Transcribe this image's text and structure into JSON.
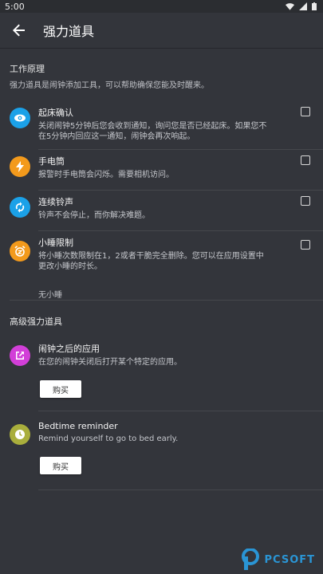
{
  "status": {
    "time": "5:00"
  },
  "header": {
    "title": "强力道具"
  },
  "section1": {
    "title": "工作原理",
    "desc": "强力道具是闹钟添加工具，可以帮助确保您能及时醒来。",
    "items": [
      {
        "title": "起床确认",
        "desc": "关闭闹钟5分钟后您会收到通知，询问您是否已经起床。如果您不在5分钟内回应这一通知，闹钟会再次响起。",
        "color": "#1ba1e8",
        "icon": "eye-icon"
      },
      {
        "title": "手电筒",
        "desc": "报警时手电筒会闪烁。需要相机访问。",
        "color": "#f39a1c",
        "icon": "flash-icon"
      },
      {
        "title": "连续铃声",
        "desc": "铃声不会停止，而你解决难题。",
        "color": "#1ba1e8",
        "icon": "repeat-icon"
      },
      {
        "title": "小睡限制",
        "desc": "将小睡次数限制在1，2或者干脆完全删除。您可以在应用设置中更改小睡的时长。",
        "color": "#f39a1c",
        "icon": "snooze-icon",
        "note": "无小睡"
      }
    ]
  },
  "section2": {
    "title": "高级强力道具",
    "items": [
      {
        "title": "闹钟之后的应用",
        "desc": "在您的闹钟关闭后打开某个特定的应用。",
        "color": "#d23fd8",
        "icon": "open-app-icon",
        "button": "购买"
      },
      {
        "title": "Bedtime reminder",
        "desc": "Remind yourself to go to bed early.",
        "color": "#a9ae3c",
        "icon": "clock-icon",
        "button": "购买"
      }
    ]
  },
  "watermark": {
    "text": "PCSOFT"
  }
}
